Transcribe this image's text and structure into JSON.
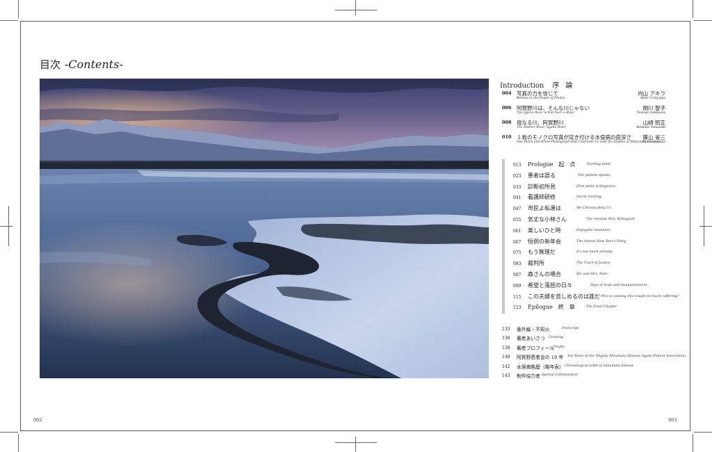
{
  "title": {
    "jp": "目次",
    "en": "-Contents-"
  },
  "photo": {
    "description_icon": "landscape-river-photo"
  },
  "introduction": {
    "label": "Introduction",
    "label_jp": "序 論",
    "items": [
      {
        "num": "004",
        "jp": "写真の力を信じて",
        "en": "Believe in the Power of Photos",
        "author": "内山 アキラ",
        "author_en": "Akira Uchiyama"
      },
      {
        "num": "006",
        "jp": "阿賀野川は、そんな川じゃない",
        "en": "The Agano River is Not Such a River",
        "author": "関川 智子",
        "author_en": "Tomoko Sekikawa"
      },
      {
        "num": "008",
        "jp": "母なる川、阿賀野川",
        "en": "The Mother River, Agano River",
        "author": "山崎 昭正",
        "author_en": "Akimasa Yamazaki"
      },
      {
        "num": "010",
        "jp": "１枚のモノクロ写真が突き付ける水俣病の底深さ",
        "en": "One Black and White Photograph that Confronts Us with the Depths of Minamata Disease",
        "author": "藤山 省三",
        "author_en": "Shozo Suyama"
      }
    ]
  },
  "chapters": [
    {
      "num": "013",
      "jp": "Prologue　起　点",
      "en": "Starting point"
    },
    {
      "num": "023",
      "jp": "患者は語る",
      "en": "The patient speaks."
    },
    {
      "num": "033",
      "jp": "診断初所見",
      "en": "First point of diagnosis"
    },
    {
      "num": "041",
      "jp": "看護師研修",
      "en": "Nurse training."
    },
    {
      "num": "047",
      "jp": "市民よ私達は",
      "en": "We Citizens,Help Us"
    },
    {
      "num": "055",
      "jp": "気丈な小林さん",
      "en": "The resolute Mrs. Kobayashi."
    },
    {
      "num": "061",
      "jp": "楽しいひと時",
      "en": "Enjoyable moments."
    },
    {
      "num": "067",
      "jp": "恒例の新年会",
      "en": "The Annual New Year's Party."
    },
    {
      "num": "075",
      "jp": "もう無理だ",
      "en": "It's too much already."
    },
    {
      "num": "083",
      "jp": "裁判所",
      "en": "The Court of Justice"
    },
    {
      "num": "087",
      "jp": "森さんの場合",
      "en": "Mr. and Mrs. Mori."
    },
    {
      "num": "099",
      "jp": "希望と落胆の日々",
      "en": "Days of hope and disappointment."
    },
    {
      "num": "115",
      "jp": "この夫婦を苦しめるのは誰だ",
      "en": "Who is causing this couple so much suffering?"
    },
    {
      "num": "123",
      "jp": "Epilogue　終　章",
      "en": "The Final Chapter"
    }
  ],
  "extras": [
    {
      "num": "133",
      "jp": "番外編・不知火",
      "en": "Postscript"
    },
    {
      "num": "136",
      "jp": "著者あいさつ",
      "en": "Greeting"
    },
    {
      "num": "138",
      "jp": "著者プロフィール",
      "en": "Profile"
    },
    {
      "num": "140",
      "jp": "阿賀野患者会の 10 年",
      "en": "Ten Years of the Niigata Minamata Disease Agano Patient Association"
    },
    {
      "num": "142",
      "jp": "水俣病略歴（略年表）",
      "en": "Chronological table of minamata disease"
    },
    {
      "num": "143",
      "jp": "制作協力者",
      "en": "Special Collaborators"
    }
  ],
  "folio": {
    "left": "002",
    "right": "003"
  },
  "colors": {
    "water": "#4a6a96",
    "snow": "#c7d4ea",
    "sky": "#46507a"
  }
}
